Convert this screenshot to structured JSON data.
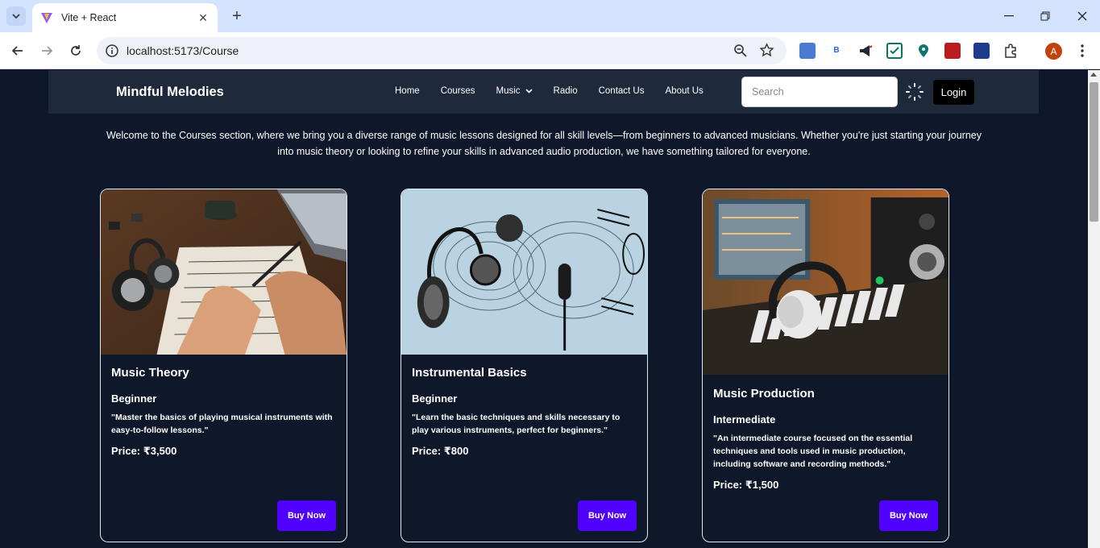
{
  "browser": {
    "tab_title": "Vite + React",
    "url": "localhost:5173/Course",
    "profile_initial": "A"
  },
  "navbar": {
    "brand": "Mindful Melodies",
    "links": [
      "Home",
      "Courses",
      "Music",
      "Radio",
      "Contact Us",
      "About Us"
    ],
    "search_placeholder": "Search",
    "login_label": "Login"
  },
  "intro": "Welcome to the Courses section, where we bring you a diverse range of music lessons designed for all skill levels—from beginners to advanced musicians. Whether you're just starting your journey into music theory or looking to refine your skills in advanced audio production, we have something tailored for everyone.",
  "courses": [
    {
      "title": "Music Theory",
      "level": "Beginner",
      "description": "\"Master the basics of playing musical instruments with easy-to-follow lessons.\"",
      "price": "Price: ₹3,500",
      "button": "Buy Now"
    },
    {
      "title": "Instrumental Basics",
      "level": "Beginner",
      "description": "\"Learn the basic techniques and skills necessary to play various instruments, perfect for beginners.\"",
      "price": "Price: ₹800",
      "button": "Buy Now"
    },
    {
      "title": "Music Production",
      "level": "Intermediate",
      "description": "\"An intermediate course focused on the essential techniques and tools used in music production, including software and recording methods.\"",
      "price": "Price: ₹1,500",
      "button": "Buy Now"
    }
  ],
  "colors": {
    "page_bg": "#0f172a",
    "navbar_bg": "#1e293b",
    "button_accent": "#4f00ff"
  }
}
